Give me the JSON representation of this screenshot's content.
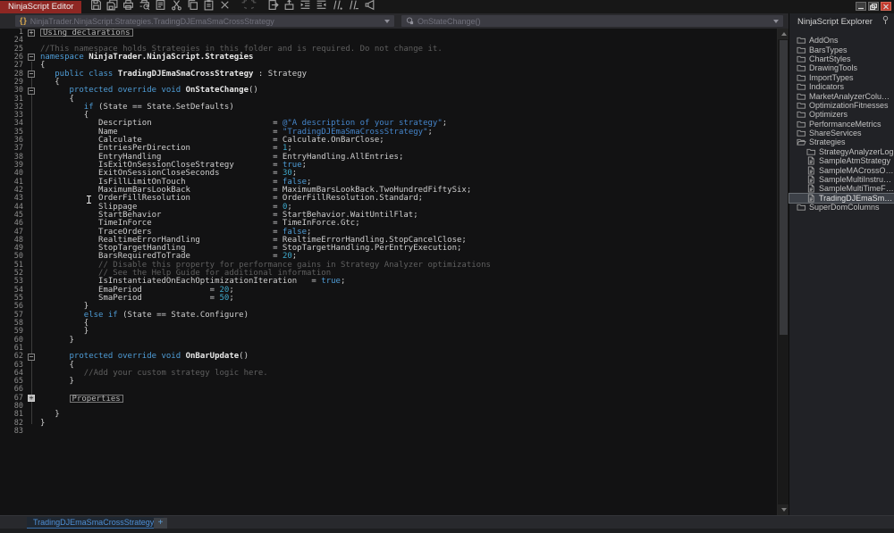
{
  "window": {
    "title": "NinjaScript Editor"
  },
  "colors": {
    "title_label_bg": "#8e2723",
    "keyword_blue": "#4e9cd6",
    "string_blue": "#4585ca",
    "number_teal": "#3fa9cc",
    "comment_gray": "#5f5f5f",
    "tab_blue": "#4e8fd5",
    "editor_bg": "#121213",
    "panel_bg": "#212226"
  },
  "toolbar": {
    "icons": [
      {
        "name": "save-icon",
        "icon": "save",
        "disabled": false
      },
      {
        "name": "save-all-icon",
        "icon": "saveall",
        "disabled": false
      },
      {
        "name": "print-icon",
        "icon": "print",
        "disabled": false
      },
      {
        "name": "print-preview-icon",
        "icon": "printpreview",
        "disabled": false
      },
      {
        "name": "template-icon",
        "icon": "template",
        "disabled": false
      },
      {
        "name": "cut-icon",
        "icon": "cut",
        "disabled": false
      },
      {
        "name": "copy-icon",
        "icon": "copy",
        "disabled": false
      },
      {
        "name": "paste-icon",
        "icon": "paste",
        "disabled": false
      },
      {
        "name": "delete-icon",
        "icon": "delete",
        "disabled": false
      },
      {
        "name": "undo-icon",
        "icon": "undo",
        "disabled": true
      },
      {
        "name": "redo-icon",
        "icon": "redo",
        "disabled": true
      },
      {
        "name": "goto-definition-icon",
        "icon": "goto",
        "disabled": false
      },
      {
        "name": "build-icon",
        "icon": "build",
        "disabled": false
      },
      {
        "name": "indent-icon",
        "icon": "indent",
        "disabled": false
      },
      {
        "name": "outdent-icon",
        "icon": "outdent",
        "disabled": false
      },
      {
        "name": "comment-icon",
        "icon": "comment",
        "disabled": false
      },
      {
        "name": "uncomment-icon",
        "icon": "uncomment",
        "disabled": false
      },
      {
        "name": "compile-icon",
        "icon": "compile",
        "disabled": false
      }
    ]
  },
  "navbar": {
    "type_value": "NinjaTrader.NinjaScript.Strategies.TradingDJEmaSmaCrossStrategy",
    "member_value": "OnStateChange()"
  },
  "editor": {
    "lines": [
      {
        "n": "1",
        "f": "+",
        "seg": [
          [
            "x",
            "Using declarations"
          ]
        ]
      },
      {
        "n": "24",
        "seg": []
      },
      {
        "n": "25",
        "seg": [
          [
            "c",
            "//This namespace holds Strategies in this folder and is required. Do not change it."
          ]
        ]
      },
      {
        "n": "26",
        "f": "-",
        "seg": [
          [
            "k",
            "namespace "
          ],
          [
            "b",
            "NinjaTrader.NinjaScript.Strategies"
          ]
        ]
      },
      {
        "n": "27",
        "seg": [
          [
            "p",
            "{"
          ]
        ]
      },
      {
        "n": "28",
        "f": "-",
        "seg": [
          [
            "p",
            "   "
          ],
          [
            "k",
            "public class "
          ],
          [
            "b",
            "TradingDJEmaSmaCrossStrategy"
          ],
          [
            "p",
            " : Strategy"
          ]
        ]
      },
      {
        "n": "29",
        "seg": [
          [
            "p",
            "   {"
          ]
        ]
      },
      {
        "n": "30",
        "f": "-",
        "seg": [
          [
            "p",
            "      "
          ],
          [
            "k",
            "protected override void "
          ],
          [
            "b",
            "OnStateChange"
          ],
          [
            "p",
            "()"
          ]
        ]
      },
      {
        "n": "31",
        "seg": [
          [
            "p",
            "      {"
          ]
        ]
      },
      {
        "n": "32",
        "seg": [
          [
            "p",
            "         "
          ],
          [
            "k",
            "if"
          ],
          [
            "p",
            " (State == State.SetDefaults)"
          ]
        ]
      },
      {
        "n": "33",
        "seg": [
          [
            "p",
            "         {"
          ]
        ]
      },
      {
        "n": "34",
        "seg": [
          [
            "p",
            "            Description                         = "
          ],
          [
            "s",
            "@\"A description of your strategy\""
          ],
          [
            "p",
            ";"
          ]
        ]
      },
      {
        "n": "35",
        "seg": [
          [
            "p",
            "            Name                                = "
          ],
          [
            "s",
            "\"TradingDJEmaSmaCrossStrategy\""
          ],
          [
            "p",
            ";"
          ]
        ]
      },
      {
        "n": "36",
        "seg": [
          [
            "p",
            "            Calculate                           = Calculate.OnBarClose;"
          ]
        ]
      },
      {
        "n": "37",
        "seg": [
          [
            "p",
            "            EntriesPerDirection                 = "
          ],
          [
            "n",
            "1"
          ],
          [
            "p",
            ";"
          ]
        ]
      },
      {
        "n": "38",
        "seg": [
          [
            "p",
            "            EntryHandling                       = EntryHandling.AllEntries;"
          ]
        ]
      },
      {
        "n": "39",
        "seg": [
          [
            "p",
            "            IsExitOnSessionCloseStrategy        = "
          ],
          [
            "k",
            "true"
          ],
          [
            "p",
            ";"
          ]
        ]
      },
      {
        "n": "40",
        "seg": [
          [
            "p",
            "            ExitOnSessionCloseSeconds           = "
          ],
          [
            "n",
            "30"
          ],
          [
            "p",
            ";"
          ]
        ]
      },
      {
        "n": "41",
        "seg": [
          [
            "p",
            "            IsFillLimitOnTouch                  = "
          ],
          [
            "k",
            "false"
          ],
          [
            "p",
            ";"
          ]
        ]
      },
      {
        "n": "42",
        "seg": [
          [
            "p",
            "            MaximumBarsLookBack                 = MaximumBarsLookBack.TwoHundredFiftySix;"
          ]
        ]
      },
      {
        "n": "43",
        "seg": [
          [
            "p",
            "            OrderFillResolution                 = OrderFillResolution.Standard;"
          ]
        ]
      },
      {
        "n": "44",
        "seg": [
          [
            "p",
            "            Slippage                            = "
          ],
          [
            "n",
            "0"
          ],
          [
            "p",
            ";"
          ]
        ]
      },
      {
        "n": "45",
        "seg": [
          [
            "p",
            "            StartBehavior                       = StartBehavior.WaitUntilFlat;"
          ]
        ]
      },
      {
        "n": "46",
        "seg": [
          [
            "p",
            "            TimeInForce                         = TimeInForce.Gtc;"
          ]
        ]
      },
      {
        "n": "47",
        "seg": [
          [
            "p",
            "            TraceOrders                         = "
          ],
          [
            "k",
            "false"
          ],
          [
            "p",
            ";"
          ]
        ]
      },
      {
        "n": "48",
        "seg": [
          [
            "p",
            "            RealtimeErrorHandling               = RealtimeErrorHandling.StopCancelClose;"
          ]
        ]
      },
      {
        "n": "49",
        "seg": [
          [
            "p",
            "            StopTargetHandling                  = StopTargetHandling.PerEntryExecution;"
          ]
        ]
      },
      {
        "n": "50",
        "seg": [
          [
            "p",
            "            BarsRequiredToTrade                 = "
          ],
          [
            "n",
            "20"
          ],
          [
            "p",
            ";"
          ]
        ]
      },
      {
        "n": "51",
        "seg": [
          [
            "c",
            "            // Disable this property for performance gains in Strategy Analyzer optimizations"
          ]
        ]
      },
      {
        "n": "52",
        "seg": [
          [
            "c",
            "            // See the Help Guide for additional information"
          ]
        ]
      },
      {
        "n": "53",
        "seg": [
          [
            "p",
            "            IsInstantiatedOnEachOptimizationIteration   = "
          ],
          [
            "k",
            "true"
          ],
          [
            "p",
            ";"
          ]
        ]
      },
      {
        "n": "54",
        "seg": [
          [
            "p",
            "            EmaPeriod              = "
          ],
          [
            "n",
            "20"
          ],
          [
            "p",
            ";"
          ]
        ]
      },
      {
        "n": "55",
        "seg": [
          [
            "p",
            "            SmaPeriod              = "
          ],
          [
            "n",
            "50"
          ],
          [
            "p",
            ";"
          ]
        ]
      },
      {
        "n": "56",
        "seg": [
          [
            "p",
            "         }"
          ]
        ]
      },
      {
        "n": "57",
        "seg": [
          [
            "p",
            "         "
          ],
          [
            "k",
            "else if"
          ],
          [
            "p",
            " (State == State.Configure)"
          ]
        ]
      },
      {
        "n": "58",
        "seg": [
          [
            "p",
            "         {"
          ]
        ]
      },
      {
        "n": "59",
        "seg": [
          [
            "p",
            "         }"
          ]
        ]
      },
      {
        "n": "60",
        "seg": [
          [
            "p",
            "      }"
          ]
        ]
      },
      {
        "n": "61",
        "seg": []
      },
      {
        "n": "62",
        "f": "-",
        "seg": [
          [
            "p",
            "      "
          ],
          [
            "k",
            "protected override void "
          ],
          [
            "b",
            "OnBarUpdate"
          ],
          [
            "p",
            "()"
          ]
        ]
      },
      {
        "n": "63",
        "seg": [
          [
            "p",
            "      {"
          ]
        ]
      },
      {
        "n": "64",
        "seg": [
          [
            "c",
            "         //Add your custom strategy logic here."
          ]
        ]
      },
      {
        "n": "65",
        "seg": [
          [
            "p",
            "      }"
          ]
        ]
      },
      {
        "n": "66",
        "seg": []
      },
      {
        "n": "67",
        "f": "+",
        "ffill": true,
        "seg": [
          [
            "p",
            "      "
          ],
          [
            "x",
            "Properties"
          ]
        ]
      },
      {
        "n": "80",
        "seg": []
      },
      {
        "n": "81",
        "seg": [
          [
            "p",
            "   }"
          ]
        ]
      },
      {
        "n": "82",
        "seg": [
          [
            "p",
            "}"
          ]
        ]
      },
      {
        "n": "83",
        "seg": []
      }
    ]
  },
  "explorer": {
    "title": "NinjaScript Explorer",
    "items": [
      {
        "label": "AddOns",
        "depth": 0,
        "icon": "folder",
        "selected": false
      },
      {
        "label": "BarsTypes",
        "depth": 0,
        "icon": "folder",
        "selected": false
      },
      {
        "label": "ChartStyles",
        "depth": 0,
        "icon": "folder",
        "selected": false
      },
      {
        "label": "DrawingTools",
        "depth": 0,
        "icon": "folder",
        "selected": false
      },
      {
        "label": "ImportTypes",
        "depth": 0,
        "icon": "folder",
        "selected": false
      },
      {
        "label": "Indicators",
        "depth": 0,
        "icon": "folder",
        "selected": false
      },
      {
        "label": "MarketAnalyzerColumns",
        "depth": 0,
        "icon": "folder",
        "selected": false
      },
      {
        "label": "OptimizationFitnesses",
        "depth": 0,
        "icon": "folder",
        "selected": false
      },
      {
        "label": "Optimizers",
        "depth": 0,
        "icon": "folder",
        "selected": false
      },
      {
        "label": "PerformanceMetrics",
        "depth": 0,
        "icon": "folder",
        "selected": false
      },
      {
        "label": "ShareServices",
        "depth": 0,
        "icon": "folder",
        "selected": false
      },
      {
        "label": "Strategies",
        "depth": 0,
        "icon": "folder-open",
        "selected": false
      },
      {
        "label": "StrategyAnalyzerLog",
        "depth": 1,
        "icon": "folder",
        "selected": false
      },
      {
        "label": "SampleAtmStrategy",
        "depth": 1,
        "icon": "doc",
        "selected": false
      },
      {
        "label": "SampleMACrossOver",
        "depth": 1,
        "icon": "doc",
        "selected": false
      },
      {
        "label": "SampleMultiInstrument",
        "depth": 1,
        "icon": "doc",
        "selected": false
      },
      {
        "label": "SampleMultiTimeFrame",
        "depth": 1,
        "icon": "doc",
        "selected": false
      },
      {
        "label": "TradingDJEmaSmaCro...",
        "depth": 1,
        "icon": "doc",
        "selected": true
      },
      {
        "label": "SuperDomColumns",
        "depth": 0,
        "icon": "folder",
        "selected": false
      }
    ]
  },
  "tabs": {
    "active_label": "TradingDJEmaSmaCrossStrategy*",
    "add_label": "+"
  }
}
